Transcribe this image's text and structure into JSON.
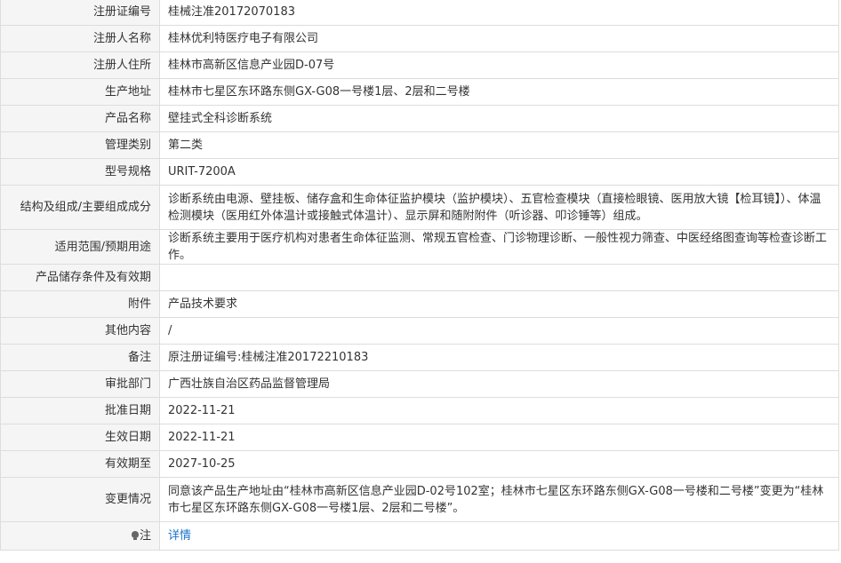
{
  "rows": [
    {
      "label": "注册证编号",
      "value": "桂械注准20172070183"
    },
    {
      "label": "注册人名称",
      "value": "桂林优利特医疗电子有限公司"
    },
    {
      "label": "注册人住所",
      "value": "桂林市高新区信息产业园D-07号"
    },
    {
      "label": "生产地址",
      "value": "桂林市七星区东环路东侧GX-G08一号楼1层、2层和二号楼"
    },
    {
      "label": "产品名称",
      "value": "壁挂式全科诊断系统"
    },
    {
      "label": "管理类别",
      "value": "第二类"
    },
    {
      "label": "型号规格",
      "value": "URIT-7200A"
    },
    {
      "label": "结构及组成/主要组成成分",
      "value": "诊断系统由电源、壁挂板、储存盒和生命体征监护模块（监护模块）、五官检查模块（直接检眼镜、医用放大镜【检耳镜】）、体温检测模块（医用红外体温计或接触式体温计）、显示屏和随附附件（听诊器、叩诊锤等）组成。"
    },
    {
      "label": "适用范围/预期用途",
      "value": "诊断系统主要用于医疗机构对患者生命体征监测、常规五官检查、门诊物理诊断、一般性视力筛查、中医经络图查询等检查诊断工作。"
    },
    {
      "label": "产品储存条件及有效期",
      "value": ""
    },
    {
      "label": "附件",
      "value": "产品技术要求"
    },
    {
      "label": "其他内容",
      "value": "/"
    },
    {
      "label": "备注",
      "value": "原注册证编号:桂械注准20172210183"
    },
    {
      "label": "审批部门",
      "value": "广西壮族自治区药品监督管理局"
    },
    {
      "label": "批准日期",
      "value": "2022-11-21"
    },
    {
      "label": "生效日期",
      "value": "2022-11-21"
    },
    {
      "label": "有效期至",
      "value": "2027-10-25"
    },
    {
      "label": "变更情况",
      "value": "同意该产品生产地址由“桂林市高新区信息产业园D-02号102室；桂林市七星区东环路东侧GX-G08一号楼和二号楼”变更为“桂林市七星区东环路东侧GX-G08一号楼1层、2层和二号楼”。"
    }
  ],
  "note": {
    "label": "注",
    "icon": "lightbulb-icon",
    "link_text": "详情",
    "link_color": "#1a73c8"
  }
}
